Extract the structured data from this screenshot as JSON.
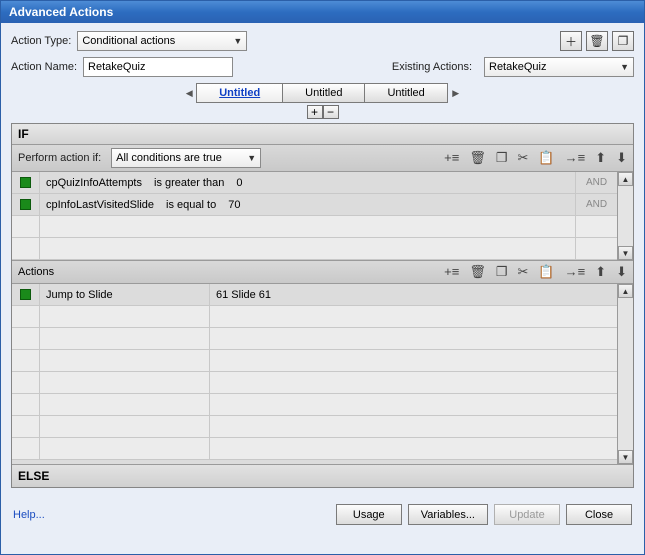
{
  "title": "Advanced Actions",
  "topbar": {
    "action_type_label": "Action Type:",
    "action_type_value": "Conditional actions",
    "action_name_label": "Action Name:",
    "action_name_value": "RetakeQuiz",
    "existing_actions_label": "Existing Actions:",
    "existing_actions_value": "RetakeQuiz"
  },
  "tabs": {
    "items": [
      {
        "label": "Untitled",
        "active": true
      },
      {
        "label": "Untitled",
        "active": false
      },
      {
        "label": "Untitled",
        "active": false
      }
    ]
  },
  "if_section": {
    "header": "IF",
    "perform_label": "Perform action if:",
    "perform_value": "All conditions are true",
    "conditions": [
      {
        "variable": "cpQuizInfoAttempts",
        "operator": "is greater than",
        "value": "0",
        "connector": "AND"
      },
      {
        "variable": "cpInfoLastVisitedSlide",
        "operator": "is equal to",
        "value": "70",
        "connector": "AND"
      }
    ]
  },
  "actions_section": {
    "header": "Actions",
    "rows": [
      {
        "action": "Jump to Slide",
        "target": "61 Slide 61"
      }
    ]
  },
  "else_section": {
    "header": "ELSE"
  },
  "footer": {
    "help": "Help...",
    "usage": "Usage",
    "variables": "Variables...",
    "update": "Update",
    "close": "Close"
  },
  "icons": {
    "plus": "+",
    "trash": "🗑",
    "dup": "❐",
    "cut": "✂",
    "paste": "📋",
    "indent": "→",
    "up": "▲",
    "down": "▼",
    "add": "+≡"
  }
}
